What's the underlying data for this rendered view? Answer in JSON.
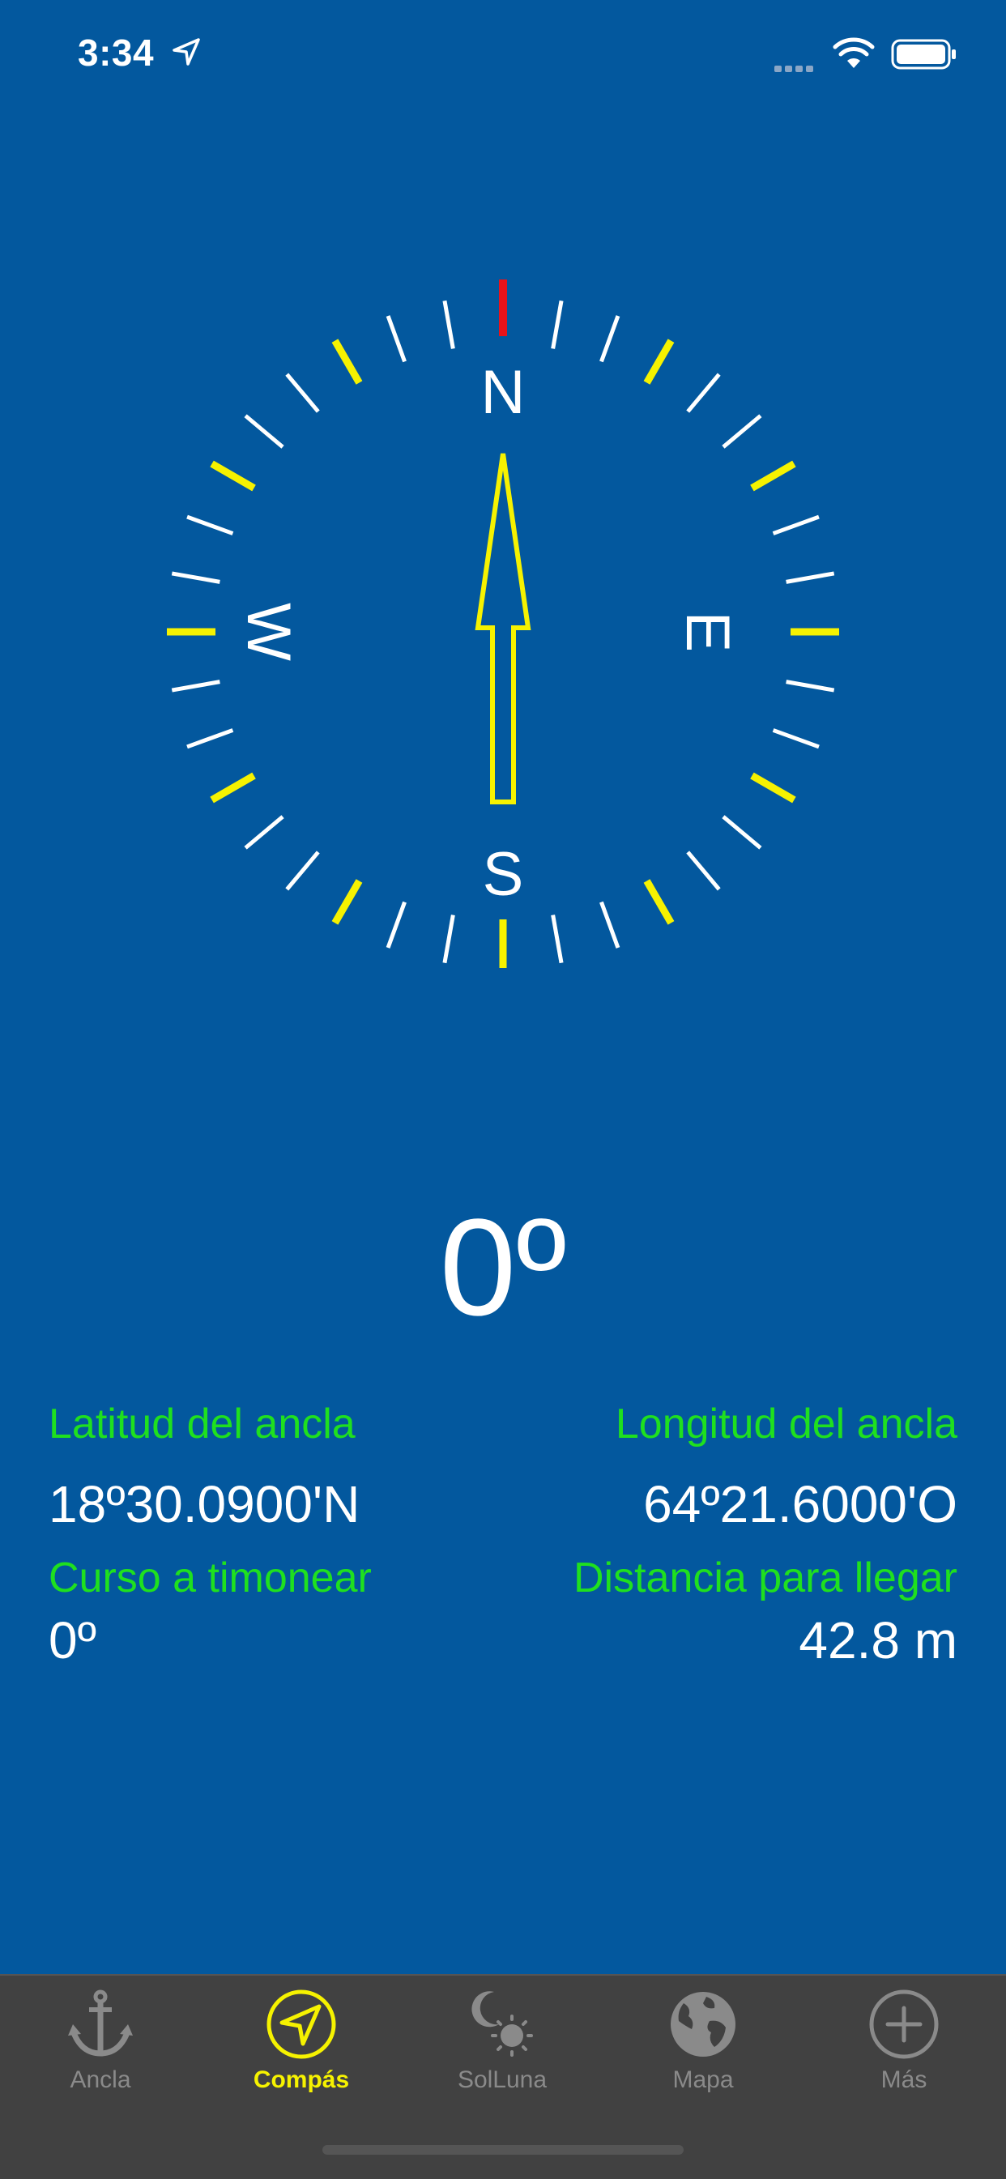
{
  "status_bar": {
    "time": "3:34",
    "icons": [
      "location-arrow-icon",
      "cellular-signal-icon",
      "wifi-icon",
      "battery-icon"
    ]
  },
  "compass": {
    "cardinals": {
      "north": "N",
      "east": "E",
      "south": "S",
      "west": "W"
    },
    "rotation_deg": 0,
    "colors": {
      "north_tick": "#e8131a",
      "major_tick": "#f6f200",
      "minor_tick": "#ffffff",
      "needle": "#f6f200"
    }
  },
  "heading": {
    "value": "0º"
  },
  "info": {
    "anchor_latitude_label": "Latitud del ancla",
    "anchor_latitude_value": "18º30.0900'N",
    "anchor_longitude_label": "Longitud del ancla",
    "anchor_longitude_value": "64º21.6000'O",
    "course_label": "Curso a timonear",
    "course_value": "0º",
    "distance_label": "Distancia para llegar",
    "distance_value": "42.8 m"
  },
  "colors": {
    "background": "#03589e",
    "label_green": "#1fe01f",
    "tab_bar": "#414141",
    "tab_active": "#f6f200",
    "tab_inactive": "#8a8a8a"
  },
  "tab_bar": {
    "items": [
      {
        "label": "Ancla",
        "icon": "anchor-icon",
        "active": false
      },
      {
        "label": "Compás",
        "icon": "navigation-arrow-icon",
        "active": true
      },
      {
        "label": "SolLuna",
        "icon": "sun-moon-icon",
        "active": false
      },
      {
        "label": "Mapa",
        "icon": "globe-icon",
        "active": false
      },
      {
        "label": "Más",
        "icon": "plus-circle-icon",
        "active": false
      }
    ]
  }
}
